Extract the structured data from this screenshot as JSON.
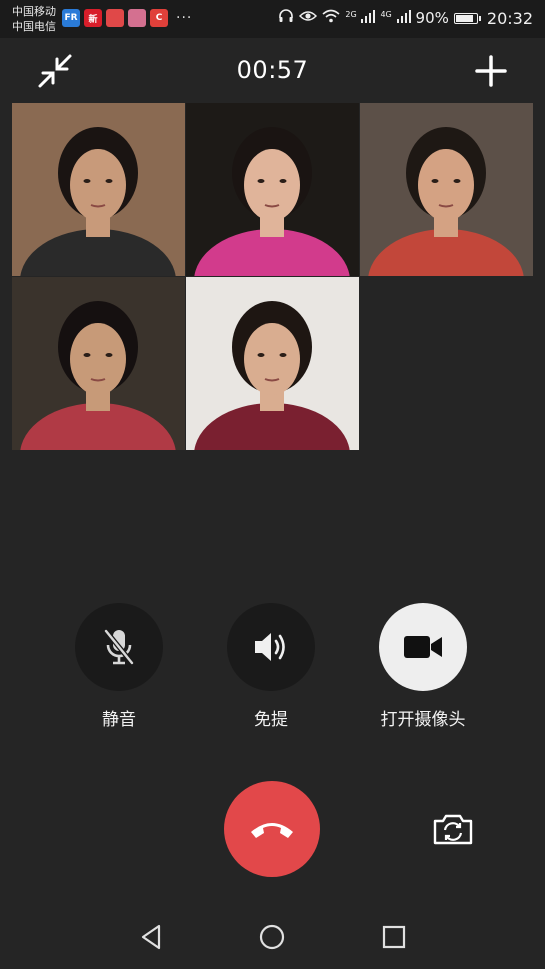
{
  "status_bar": {
    "carrier_1": "中国移动",
    "carrier_2": "中国电信",
    "app_icons": [
      {
        "name": "fr-app-icon",
        "text": "FR",
        "color": "#2a7bd8"
      },
      {
        "name": "news-app-icon",
        "text": "新",
        "color": "#d81e2a"
      },
      {
        "name": "map-app-icon",
        "text": "",
        "color": "#e04848"
      },
      {
        "name": "gallery-app-icon",
        "text": "",
        "color": "#d47090"
      },
      {
        "name": "camera-app-icon",
        "text": "C",
        "color": "#e0403a"
      }
    ],
    "more": "···",
    "net_2g": "2G",
    "net_4g": "4G",
    "battery": "90%",
    "battery_level": 0.9,
    "time": "20:32"
  },
  "call": {
    "duration": "00:57"
  },
  "participants": [
    {
      "id": "p1",
      "bg": "#8a6a52",
      "shirt": "#2a2a2a",
      "skin": "#c89a7a",
      "hair": "#1a1412"
    },
    {
      "id": "p2",
      "bg": "#1d1a17",
      "shirt": "#d23b8c",
      "skin": "#e0b49a",
      "hair": "#1a1412"
    },
    {
      "id": "p3",
      "bg": "#5c5048",
      "shirt": "#c2473a",
      "skin": "#d4a283",
      "hair": "#1e1814"
    },
    {
      "id": "p4",
      "bg": "#3a332c",
      "shirt": "#b03a45",
      "skin": "#c79a78",
      "hair": "#151010"
    },
    {
      "id": "p5",
      "bg": "#e9e6e2",
      "shirt": "#7a2030",
      "skin": "#d9ad90",
      "hair": "#1e1612"
    }
  ],
  "controls": {
    "mute_label": "静音",
    "speaker_label": "免提",
    "camera_label": "打开摄像头"
  },
  "colors": {
    "background": "#252525",
    "control_dark": "#1a1a1a",
    "control_light": "#eeeeee",
    "hangup": "#e2484a"
  },
  "icons": {
    "minimize": "minimize-arrows-icon",
    "add": "plus-icon",
    "mute": "microphone-off-icon",
    "speaker": "speaker-icon",
    "camera": "video-camera-icon",
    "hangup": "phone-hangup-icon",
    "switch_camera": "camera-switch-icon",
    "back": "nav-back-icon",
    "home": "nav-home-icon",
    "recents": "nav-recents-icon"
  }
}
